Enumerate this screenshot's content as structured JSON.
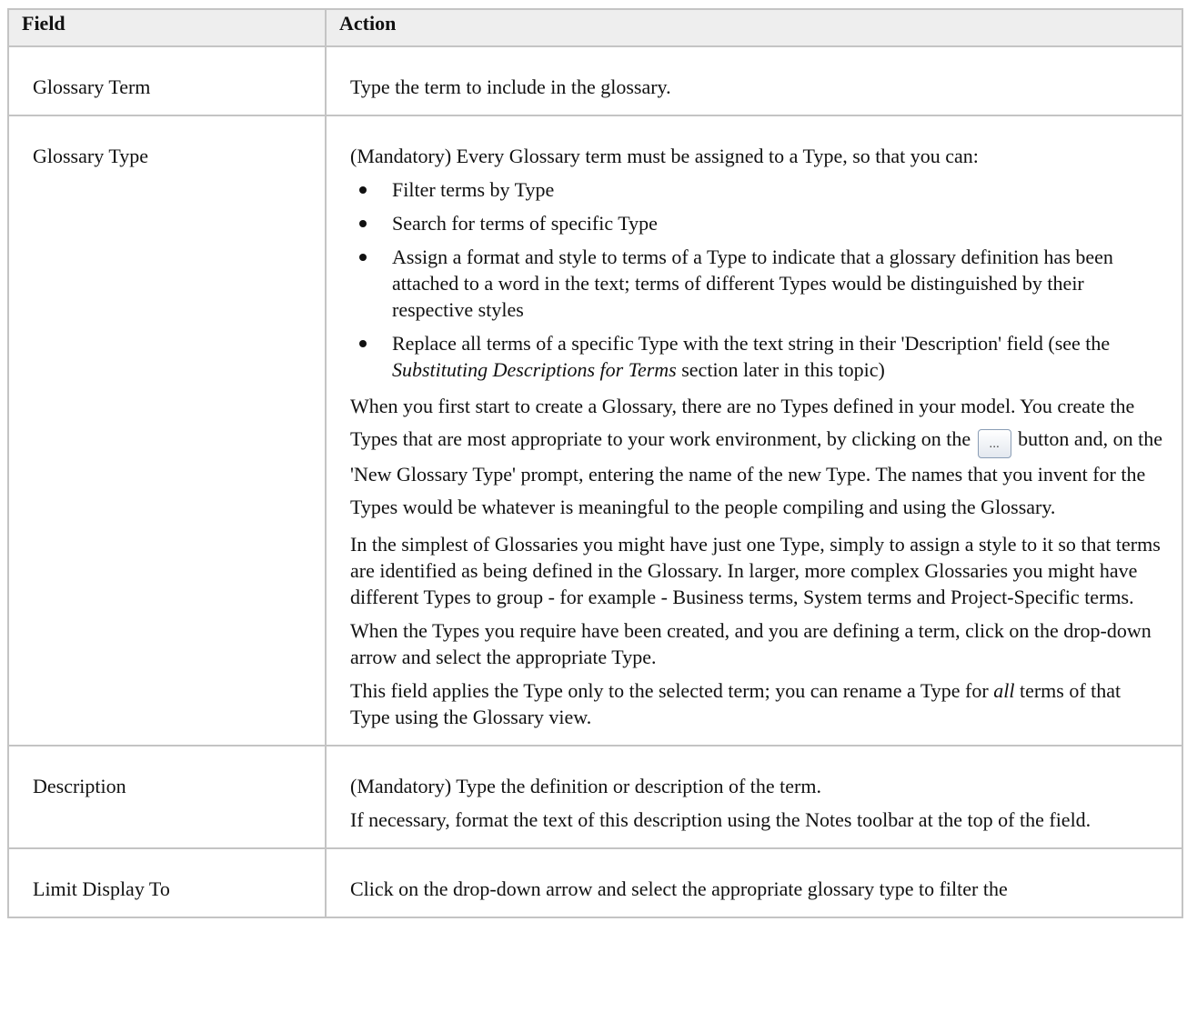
{
  "table": {
    "header": {
      "field": "Field",
      "action": "Action"
    },
    "rows": {
      "glossary_term": {
        "field": "Glossary Term",
        "action": "Type the term to include in the glossary."
      },
      "glossary_type": {
        "field": "Glossary Type",
        "intro": "(Mandatory) Every Glossary term must be assigned to a Type, so that you can:",
        "bullets": [
          "Filter terms by Type",
          "Search for terms of specific Type",
          "Assign a format and style to terms of a Type to indicate that a glossary definition has been attached to a word in the text; terms of different Types would be distinguished by their respective styles"
        ],
        "bullet4_before": "Replace all terms of a specific Type with the text string in their 'Description' field (see the ",
        "bullet4_italic": "Substituting Descriptions for Terms",
        "bullet4_after": " section later in this topic)",
        "para1_before": "When you first start to create a Glossary, there are no Types defined in your model. You create the Types that are most appropriate to your work environment, by clicking on the ",
        "para1_button": "...",
        "para1_after": " button and, on the 'New Glossary Type' prompt, entering the name of the new Type. The names that you invent for the Types would be whatever is meaningful to the people compiling and using the Glossary.",
        "para2": "In the simplest of Glossaries you might have just one Type, simply to assign a style to it so that terms are identified as being defined in the Glossary. In larger, more complex Glossaries you might have different Types to group - for example - Business terms, System terms and Project-Specific terms.",
        "para3": "When the Types you require have been created, and you are defining a term, click on the drop-down arrow and select the appropriate Type.",
        "para4_before": "This field applies the Type only to the selected term; you can rename a Type for ",
        "para4_italic": "all",
        "para4_after": " terms of that Type using the Glossary view."
      },
      "description": {
        "field": "Description",
        "para1": "(Mandatory) Type the definition or description of the term.",
        "para2": "If necessary, format the text of this description using the Notes toolbar at the top of the field."
      },
      "limit_display": {
        "field": "Limit Display To",
        "action": "Click on the drop-down arrow and select the appropriate glossary type to filter the"
      }
    }
  }
}
